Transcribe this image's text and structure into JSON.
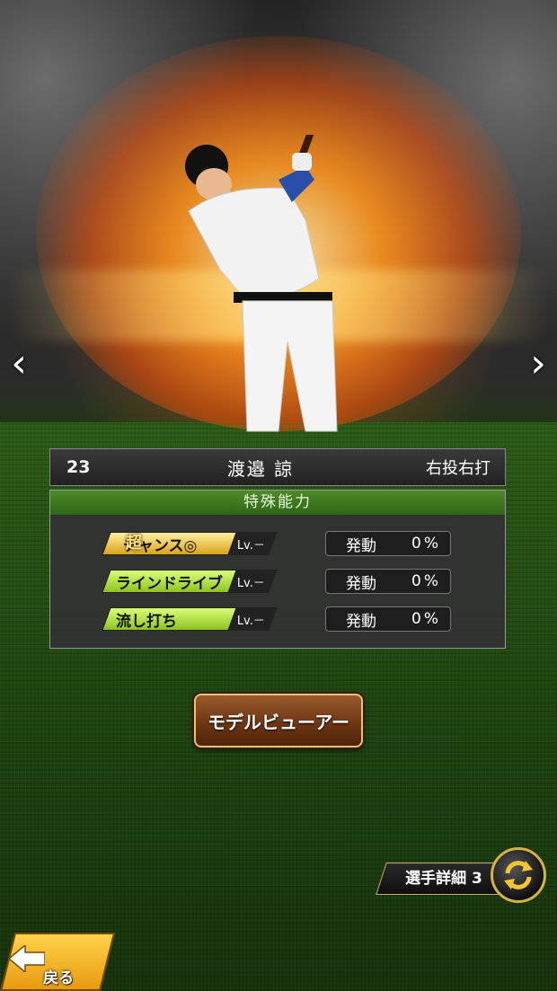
{
  "player": {
    "number": "23",
    "name": "渡邉 諒",
    "throw_bat": "右投右打"
  },
  "abilities_panel": {
    "title": "特殊能力",
    "items": [
      {
        "prefix": "超",
        "name": "チャンス◎",
        "level": "Lv.－",
        "action": "発動",
        "rate": "0%",
        "style": "gold"
      },
      {
        "prefix": "",
        "name": "ラインドライブ",
        "level": "Lv.－",
        "action": "発動",
        "rate": "0%",
        "style": "green"
      },
      {
        "prefix": "",
        "name": "流し打ち",
        "level": "Lv.－",
        "action": "発動",
        "rate": "0%",
        "style": "green"
      }
    ]
  },
  "buttons": {
    "model_viewer": "モデルビューアー",
    "player_detail": "選手詳細 3",
    "back": "戻る"
  },
  "icons": {
    "prev": "chevron-left-icon",
    "next": "chevron-right-icon",
    "switch": "rotate-arrows-icon",
    "back": "back-arrow-icon"
  },
  "colors": {
    "ability_title_bg": "#2f6616",
    "ability_green": "#8ec21f",
    "ability_gold": "#d9a31a",
    "button_brown": "#6b3412",
    "back_yellow": "#ffd34a"
  }
}
